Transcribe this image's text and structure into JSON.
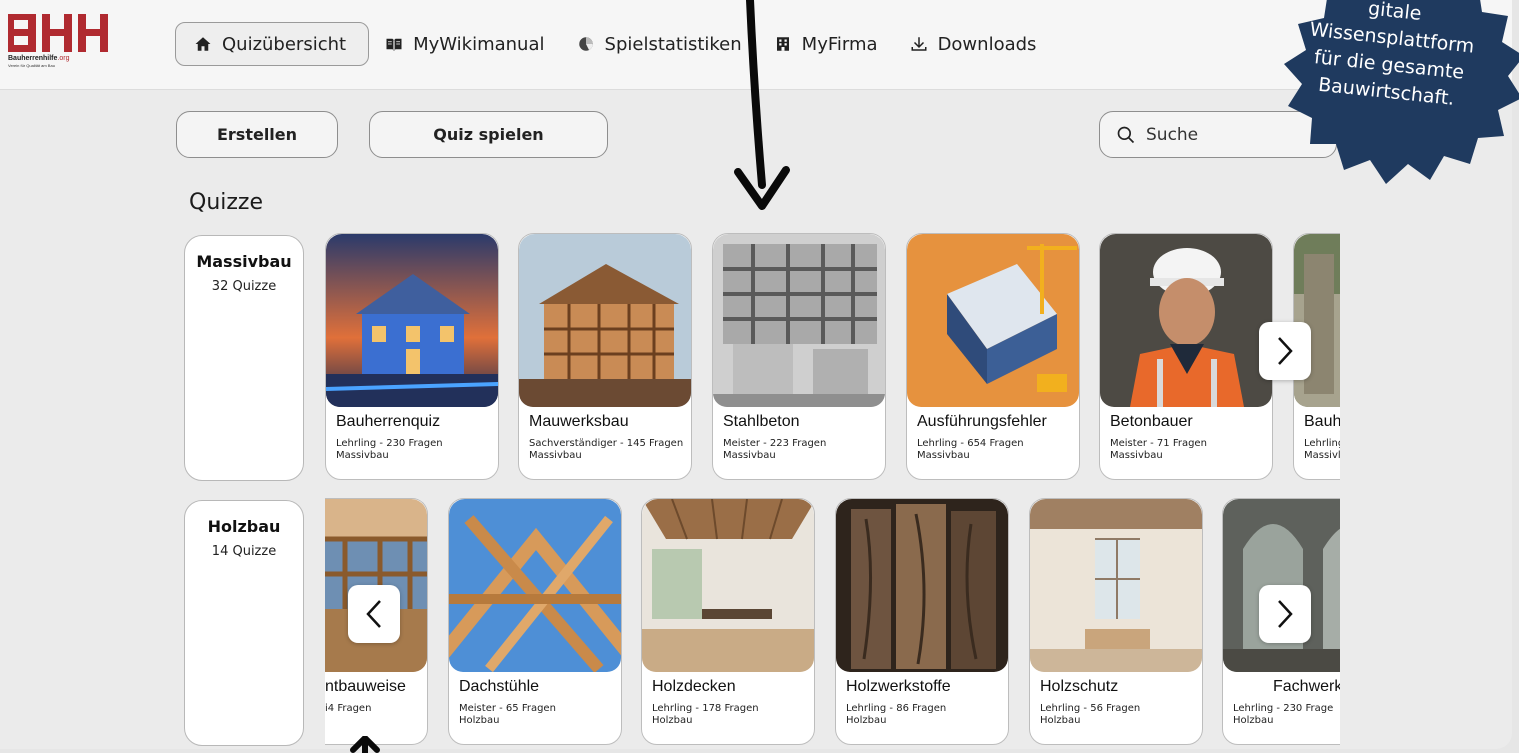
{
  "brand": {
    "logo_text": "BHH",
    "logo_name": "Bauherrenhilfe",
    "logo_tld": ".org",
    "logo_tagline": "Verein für Qualität am Bau",
    "colors": {
      "primary": "#b02a30",
      "accent": "#1f3a5f"
    }
  },
  "nav": {
    "items": [
      {
        "label": "Quizübersicht",
        "icon": "home-icon",
        "active": true
      },
      {
        "label": "MyWikimanual",
        "icon": "book-icon",
        "active": false
      },
      {
        "label": "Spielstatistiken",
        "icon": "pie-chart-icon",
        "active": false
      },
      {
        "label": "MyFirma",
        "icon": "building-icon",
        "active": false
      },
      {
        "label": "Downloads",
        "icon": "download-icon",
        "active": false
      }
    ]
  },
  "toolbar": {
    "create_label": "Erstellen",
    "play_label": "Quiz spielen",
    "search_placeholder": "Suche"
  },
  "section": {
    "title": "Quizze"
  },
  "categories": [
    {
      "name": "Massivbau",
      "count": "32 Quizze",
      "quizzes": [
        {
          "title": "Bauherrenquiz",
          "meta": "Lehrling - 230 Fragen",
          "category": "Massivbau"
        },
        {
          "title": "Mauwerksbau",
          "meta": "Sachverständiger - 145 Fragen",
          "category": "Massivbau"
        },
        {
          "title": "Stahlbeton",
          "meta": "Meister - 223 Fragen",
          "category": "Massivbau"
        },
        {
          "title": "Ausführungsfehler",
          "meta": "Lehrling - 654 Fragen",
          "category": "Massivbau"
        },
        {
          "title": "Betonbauer",
          "meta": "Meister - 71 Fragen",
          "category": "Massivbau"
        },
        {
          "title": "Bauh",
          "meta": "Lehrling",
          "category": "Massivl"
        }
      ]
    },
    {
      "name": "Holzbau",
      "count": "14 Quizze",
      "quizzes": [
        {
          "title": "ntbauweise",
          "meta": "i4 Fragen",
          "category": ""
        },
        {
          "title": "Dachstühle",
          "meta": "Meister - 65 Fragen",
          "category": "Holzbau"
        },
        {
          "title": "Holzdecken",
          "meta": "Lehrling - 178 Fragen",
          "category": "Holzbau"
        },
        {
          "title": "Holzwerkstoffe",
          "meta": "Lehrling - 86 Fragen",
          "category": "Holzbau"
        },
        {
          "title": "Holzschutz",
          "meta": "Lehrling - 56 Fragen",
          "category": "Holzbau"
        },
        {
          "title": "Fachwerke",
          "meta": "Lehrling - 230 Frage",
          "category": "Holzbau"
        }
      ]
    }
  ],
  "promo": {
    "line1": "gitale",
    "line2": "Wissensplattform",
    "line3": "für die gesamte",
    "line4": "Bauwirtschaft."
  }
}
